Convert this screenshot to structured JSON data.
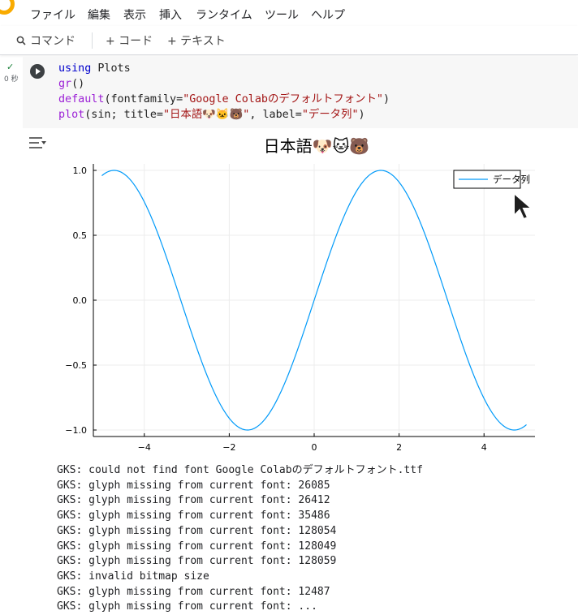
{
  "menu": [
    "ファイル",
    "編集",
    "表示",
    "挿入",
    "ランタイム",
    "ツール",
    "ヘルプ"
  ],
  "toolbar": {
    "command_label": "コマンド",
    "code_label": "+ コード",
    "text_label": "+ テキスト"
  },
  "cell": {
    "status_check": "✓",
    "exec_time": "0 秒",
    "code_lines": [
      [
        {
          "t": "using",
          "c": "kw"
        },
        {
          "t": " Plots",
          "c": "plain"
        }
      ],
      [
        {
          "t": "gr",
          "c": "fn"
        },
        {
          "t": "()",
          "c": "plain"
        }
      ],
      [
        {
          "t": "default",
          "c": "fn"
        },
        {
          "t": "(fontfamily=",
          "c": "plain"
        },
        {
          "t": "\"Google Colabのデフォルトフォント\"",
          "c": "str"
        },
        {
          "t": ")",
          "c": "plain"
        }
      ],
      [
        {
          "t": "plot",
          "c": "fn"
        },
        {
          "t": "(sin; title=",
          "c": "plain"
        },
        {
          "t": "\"日本語🐶🐱🐻\"",
          "c": "str"
        },
        {
          "t": ", label=",
          "c": "plain"
        },
        {
          "t": "\"データ列\"",
          "c": "str"
        },
        {
          "t": ")",
          "c": "plain"
        }
      ]
    ]
  },
  "chart_data": {
    "type": "line",
    "title": "日本語🐶🐱🐻",
    "xlabel": "",
    "ylabel": "",
    "xlim": [
      -5.2,
      5.2
    ],
    "ylim": [
      -1.05,
      1.05
    ],
    "x_ticks": [
      "-4",
      "-2",
      "0",
      "2",
      "4"
    ],
    "x_tick_values": [
      -4,
      -2,
      0,
      2,
      4
    ],
    "y_ticks": [
      "1.0",
      "0.5",
      "0.0",
      "-0.5",
      "-1.0"
    ],
    "y_tick_values": [
      1.0,
      0.5,
      0.0,
      -0.5,
      -1.0
    ],
    "grid": true,
    "legend": "top-right",
    "series": [
      {
        "name": "データ列",
        "function": "sin",
        "x_range": [
          -5,
          5
        ],
        "color": "#009af9"
      }
    ]
  },
  "output_lines": [
    "GKS: could not find font Google Colabのデフォルトフォント.ttf",
    "GKS: glyph missing from current font: 26085",
    "GKS: glyph missing from current font: 26412",
    "GKS: glyph missing from current font: 35486",
    "GKS: glyph missing from current font: 128054",
    "GKS: glyph missing from current font: 128049",
    "GKS: glyph missing from current font: 128059",
    "GKS: invalid bitmap size",
    "GKS: glyph missing from current font: 12487",
    "GKS: glyph missing from current font: ..."
  ],
  "colors": {
    "accent": "#f9ab00",
    "series": "#009af9"
  }
}
